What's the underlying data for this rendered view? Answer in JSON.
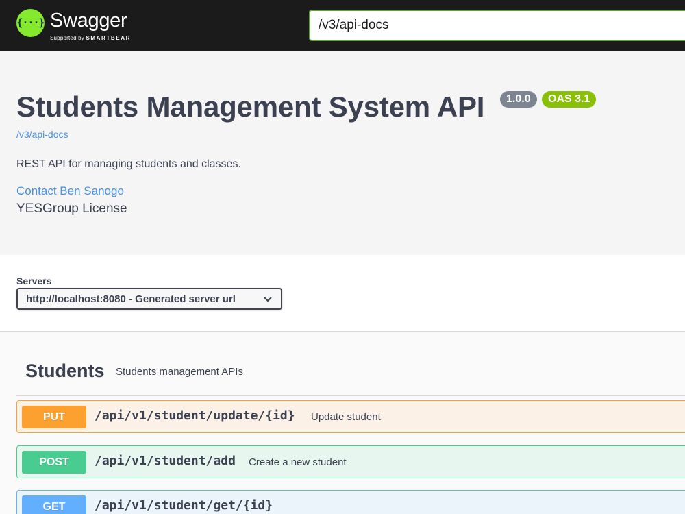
{
  "topbar": {
    "logo_glyph": "{···}",
    "brand": "Swagger",
    "tagline_prefix": "Supported by",
    "tagline_company": "SMARTBEAR",
    "url_value": "/v3/api-docs",
    "accent_color": "#85ea2d"
  },
  "info": {
    "title": "Students Management System API",
    "version_badge": "1.0.0",
    "oas_badge": "OAS 3.1",
    "spec_link": "/v3/api-docs",
    "description": "REST API for managing students and classes.",
    "contact_link": "Contact Ben Sanogo",
    "license": "YESGroup License"
  },
  "servers": {
    "label": "Servers",
    "selected": "http://localhost:8080 - Generated server url"
  },
  "tag": {
    "name": "Students",
    "description": "Students management APIs"
  },
  "operations": [
    {
      "method": "PUT",
      "path": "/api/v1/student/update/{id}",
      "summary": "Update student",
      "color": "#fca130"
    },
    {
      "method": "POST",
      "path": "/api/v1/student/add",
      "summary": "Create a new student",
      "color": "#49cc90"
    },
    {
      "method": "GET",
      "path": "/api/v1/student/get/{id}",
      "summary": "",
      "color": "#61affe"
    }
  ],
  "icons": [
    "swagger-logo-icon",
    "chevron-down-icon"
  ]
}
